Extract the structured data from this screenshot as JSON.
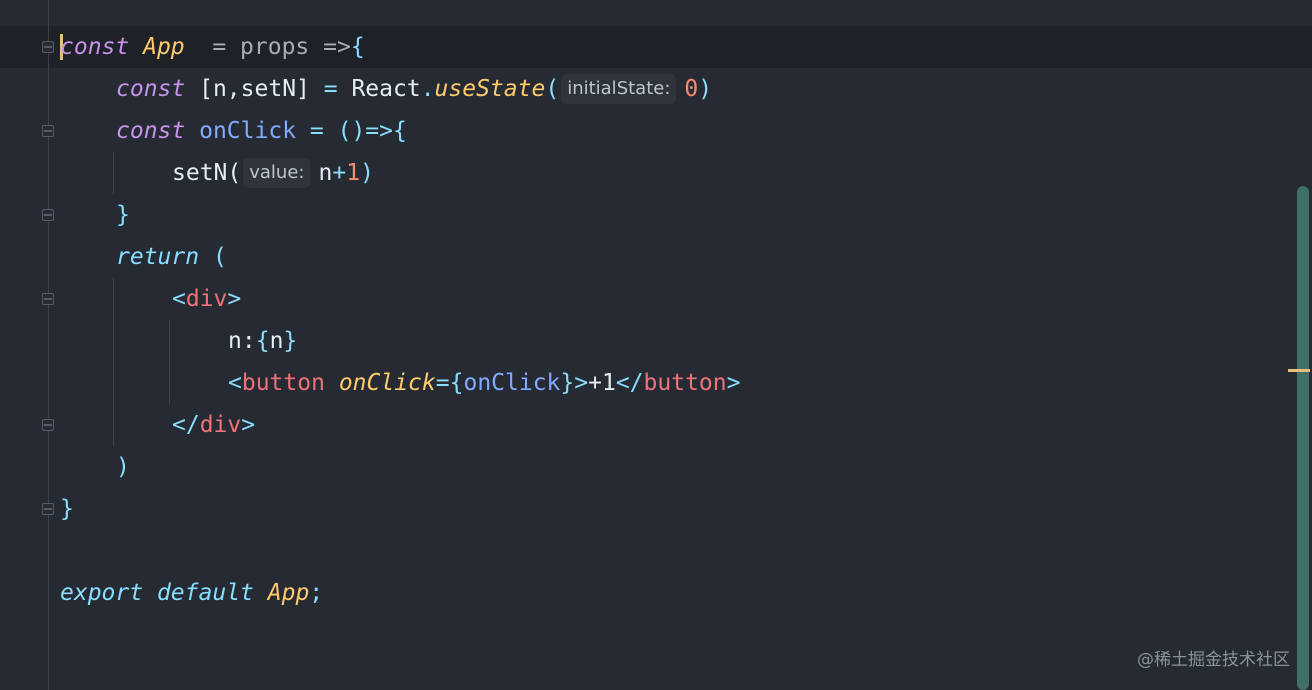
{
  "code": {
    "line1": {
      "kw": "const",
      "name": "App",
      "rest": "  = props =>",
      "brace": "{"
    },
    "line2": {
      "kw": "const",
      "destructure": "[n,setN]",
      "eq": " = ",
      "obj": "React",
      "dot": ".",
      "method": "useState",
      "open": "(",
      "hint": "initialState:",
      "arg": "0",
      "close": ")"
    },
    "line3": {
      "kw": "const",
      "name": "onClick",
      "eq": " = ",
      "arrow": "()=>{"
    },
    "line4": {
      "call": "setN(",
      "hint": "value:",
      "arg_var": "n",
      "arg_op": "+",
      "arg_num": "1",
      "close": ")"
    },
    "line5": {
      "brace": "}"
    },
    "line6": {
      "kw": "return",
      "paren": " ("
    },
    "line7": {
      "lt": "<",
      "tag": "div",
      "gt": ">"
    },
    "line8": {
      "text": "n:",
      "open": "{",
      "var": "n",
      "close": "}"
    },
    "line9": {
      "lt": "<",
      "tag": "button",
      "attr": "onClick",
      "eq": "=",
      "open": "{",
      "handler": "onClick",
      "close": "}",
      "gt": ">",
      "text": "+1",
      "end_lt": "</",
      "end_tag": "button",
      "end_gt": ">"
    },
    "line10": {
      "lt": "</",
      "tag": "div",
      "gt": ">"
    },
    "line11": {
      "paren": ")"
    },
    "line12": {
      "brace": "}"
    },
    "line14": {
      "kw1": "export",
      "kw2": "default",
      "name": "App",
      "semi": ";"
    }
  },
  "watermark": "@稀土掘金技术社区",
  "colors": {
    "background": "#262b33",
    "current_line": "#1e2228",
    "keyword": "#c792ea",
    "class_name": "#ffcb6b",
    "tag": "#f07178",
    "number": "#f78c6c",
    "punctuation": "#89ddff",
    "scrollbar": "#3e7068"
  }
}
